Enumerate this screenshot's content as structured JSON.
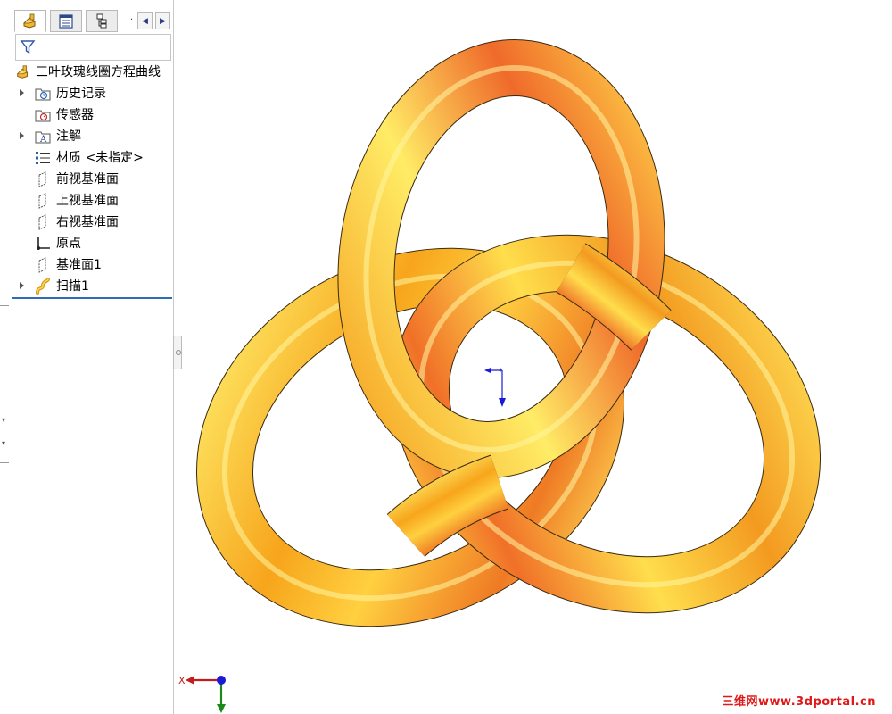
{
  "feature_tree": {
    "root_label": "三叶玫瑰线圈方程曲线",
    "items": [
      {
        "label": "历史记录",
        "icon": "history-folder-icon",
        "expandable": true
      },
      {
        "label": "传感器",
        "icon": "sensor-folder-icon",
        "expandable": false
      },
      {
        "label": "注解",
        "icon": "annotation-folder-icon",
        "expandable": true
      },
      {
        "label": "材质 <未指定>",
        "icon": "material-icon",
        "expandable": false
      },
      {
        "label": "前视基准面",
        "icon": "plane-icon",
        "expandable": false
      },
      {
        "label": "上视基准面",
        "icon": "plane-icon",
        "expandable": false
      },
      {
        "label": "右视基准面",
        "icon": "plane-icon",
        "expandable": false
      },
      {
        "label": "原点",
        "icon": "origin-icon",
        "expandable": false
      },
      {
        "label": "基准面1",
        "icon": "plane-icon",
        "expandable": false
      },
      {
        "label": "扫描1",
        "icon": "sweep-feature-icon",
        "expandable": true
      }
    ]
  },
  "tabs": [
    {
      "name": "feature-manager-tab",
      "icon": "part-icon"
    },
    {
      "name": "property-manager-tab",
      "icon": "property-list-icon"
    },
    {
      "name": "configuration-manager-tab",
      "icon": "configuration-icon"
    }
  ],
  "viewport": {
    "triad_axis_label": "X",
    "watermark": "三维网www.3dportal.cn"
  },
  "colors": {
    "knot_main": "#f7a51c",
    "knot_highlight": "#fff06a",
    "knot_shadow": "#ef5a24",
    "axis_x": "#c21c1c",
    "axis_y": "#1b8a1b",
    "axis_z": "#1a1ad6",
    "tree_end_bar": "#2d6db5"
  }
}
